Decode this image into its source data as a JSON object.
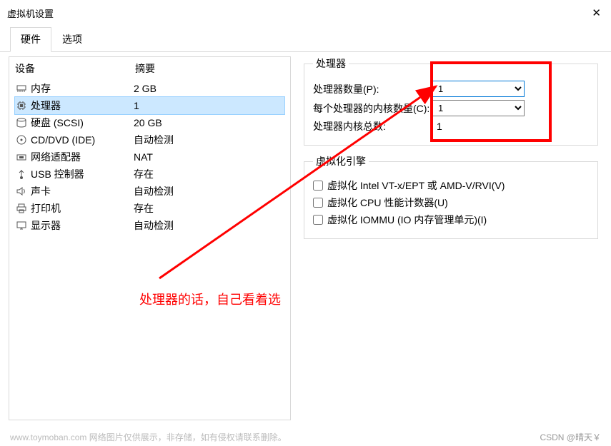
{
  "titlebar": {
    "title": "虚拟机设置",
    "close": "✕"
  },
  "tabs": {
    "hardware": "硬件",
    "options": "选项"
  },
  "left": {
    "header": {
      "device": "设备",
      "summary": "摘要"
    },
    "items": [
      {
        "icon": "memory-icon",
        "name": "内存",
        "summary": "2 GB"
      },
      {
        "icon": "cpu-icon",
        "name": "处理器",
        "summary": "1",
        "selected": true
      },
      {
        "icon": "disk-icon",
        "name": "硬盘 (SCSI)",
        "summary": "20 GB"
      },
      {
        "icon": "cd-icon",
        "name": "CD/DVD (IDE)",
        "summary": "自动检测"
      },
      {
        "icon": "network-icon",
        "name": "网络适配器",
        "summary": "NAT"
      },
      {
        "icon": "usb-icon",
        "name": "USB 控制器",
        "summary": "存在"
      },
      {
        "icon": "sound-icon",
        "name": "声卡",
        "summary": "自动检测"
      },
      {
        "icon": "printer-icon",
        "name": "打印机",
        "summary": "存在"
      },
      {
        "icon": "display-icon",
        "name": "显示器",
        "summary": "自动检测"
      }
    ]
  },
  "processor": {
    "legend": "处理器",
    "count_label": "处理器数量(P):",
    "count_value": "1",
    "cores_label": "每个处理器的内核数量(C):",
    "cores_value": "1",
    "total_label": "处理器内核总数:",
    "total_value": "1"
  },
  "virt": {
    "legend": "虚拟化引擎",
    "opt1": "虚拟化 Intel VT-x/EPT 或 AMD-V/RVI(V)",
    "opt2": "虚拟化 CPU 性能计数器(U)",
    "opt3": "虚拟化 IOMMU (IO 内存管理单元)(I)"
  },
  "annotation": "处理器的话，自己看着选",
  "footer": {
    "left": "www.toymoban.com  网络图片仅供展示，非存储，如有侵权请联系删除。",
    "right": "CSDN @晴天￥"
  }
}
